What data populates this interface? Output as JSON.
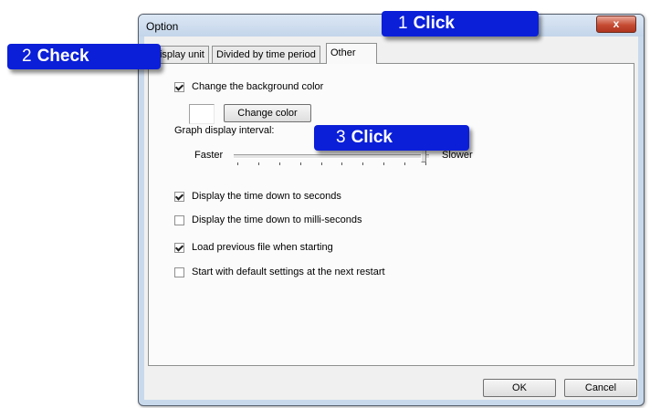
{
  "window": {
    "title": "Option",
    "close_glyph": "x"
  },
  "tabs": [
    {
      "label": "Display unit",
      "active": false
    },
    {
      "label": "Divided by time period",
      "active": false
    },
    {
      "label": "Other",
      "active": true
    }
  ],
  "other_tab": {
    "change_background": {
      "label": "Change the background color",
      "checked": true
    },
    "change_color_button": "Change color",
    "graph_interval": {
      "label": "Graph display interval:",
      "min_label": "Faster",
      "max_label": "Slower",
      "tick_count": 10,
      "value_fraction": 0.97
    },
    "options": [
      {
        "label": "Display the time down to seconds",
        "checked": true
      },
      {
        "label": "Display the time down to milli-seconds",
        "checked": false
      },
      {
        "label": "Load previous file when starting",
        "checked": true
      },
      {
        "label": "Start with default settings at the next restart",
        "checked": false
      }
    ]
  },
  "buttons": {
    "ok": "OK",
    "cancel": "Cancel"
  },
  "callouts": [
    {
      "num": "1",
      "word": "Click"
    },
    {
      "num": "2",
      "word": "Check"
    },
    {
      "num": "3",
      "word": "Click"
    }
  ],
  "colors": {
    "callout": "#0b1fd8",
    "close_button": "#c64b33",
    "dialog_frame": "#c9d9ec"
  }
}
